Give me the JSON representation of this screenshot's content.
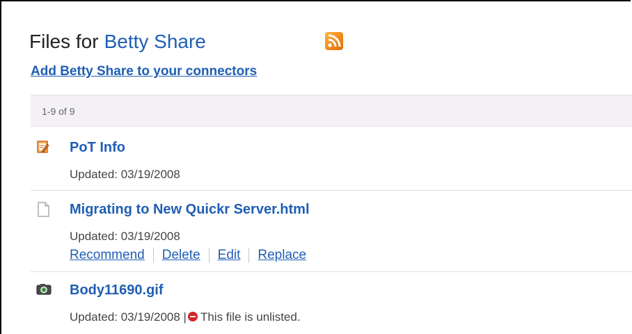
{
  "header": {
    "title_prefix": "Files for",
    "title_name": "Betty Share",
    "add_connector_link": "Add Betty Share to your connectors",
    "rss_icon": "rss-feed-icon"
  },
  "paging": {
    "text": "1-9 of 9"
  },
  "files": [
    {
      "icon": "document-edit-icon",
      "name": "PoT Info",
      "updated": "Updated: 03/19/2008"
    },
    {
      "icon": "blank-file-icon",
      "name": "Migrating to New Quickr Server.html",
      "updated": "Updated: 03/19/2008",
      "actions": [
        "Recommend",
        "Delete",
        "Edit",
        "Replace"
      ]
    },
    {
      "icon": "camera-image-icon",
      "name": "Body11690.gif",
      "updated": "Updated: 03/19/2008 |",
      "status": "This file is unlisted."
    }
  ],
  "colors": {
    "link": "#1f5eb4",
    "rss": "#f08a1c",
    "unlisted": "#d12727",
    "paging_bg": "#f3f1f4"
  }
}
